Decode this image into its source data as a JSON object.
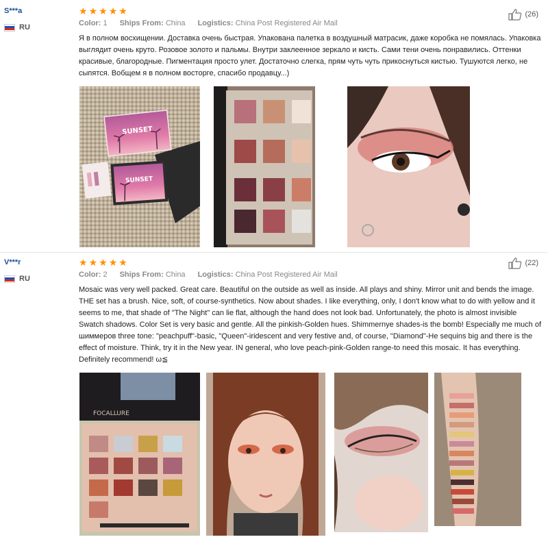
{
  "reviews": [
    {
      "user": "S***a",
      "country": "RU",
      "rating_stars": 5,
      "stars": [
        "★",
        "★",
        "★",
        "★",
        "★"
      ],
      "color_label": "Color:",
      "color_value": "1",
      "ships_label": "Ships From:",
      "ships_value": "China",
      "logistics_label": "Logistics:",
      "logistics_value": "China Post Registered Air Mail",
      "helpful_count": "(26)",
      "text": "Я в полном восхищении. Доставка очень быстрая. Упакована палетка в воздушный матрасик, даже коробка не помялась. Упаковка выглядит очень круто. Розовое золото и пальмы. Внутри заклеенное зеркало и кисть. Сами тени очень понравились. Оттенки красивые, благородные. Пигментация просто улет. Достаточно слегка, прям чуть чуть прикоснуться кистью. Тушуются легко, не сыпятся. Вобщем я в полном восторге, спасибо продавцу...)"
    },
    {
      "user": "V***r",
      "country": "RU",
      "rating_stars": 5,
      "stars": [
        "★",
        "★",
        "★",
        "★",
        "★"
      ],
      "color_label": "Color:",
      "color_value": "2",
      "ships_label": "Ships From:",
      "ships_value": "China",
      "logistics_label": "Logistics:",
      "logistics_value": "China Post Registered Air Mail",
      "helpful_count": "(22)",
      "text": "Mosaic was very well packed. Great care. Beautiful on the outside as well as inside. All plays and shiny. Mirror unit and bends the image. THE set has a brush. Nice, soft, of course-synthetics. Now about shades. I like everything, only, I don't know what to do with yellow and it seems to me, that shade of \"The Night\" can lie flat, although the hand does not look bad. Unfortunately, the photo is almost invisible Swatch shadows. Color Set is very basic and gentle. All the pinkish-Golden hues. Shimmernye shades-is the bomb! Especially me much of шиммеров three tone: \"peachpuff\"-basic, \"Queen\"-iridescent and very festive and, of course, \"Diamond\"-He sequins big and there is the effect of moisture. Think, try it in the New year. IN general, who love peach-pink-Golden range-to need this mosaic. It has everything. Definitely recommend! ω≦"
    }
  ],
  "photo_text": {
    "sunset_1": "SUNSET",
    "sunset_2": "SUNSET",
    "brand": "FOCALLURE"
  },
  "colors": {
    "star": "#ff9000",
    "username": "#1a4f9c"
  }
}
